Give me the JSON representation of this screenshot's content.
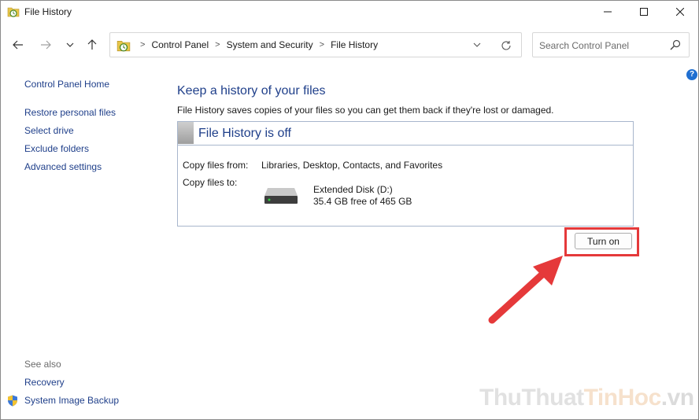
{
  "window": {
    "title": "File History"
  },
  "address": {
    "crumbs": [
      "Control Panel",
      "System and Security",
      "File History"
    ],
    "search_placeholder": "Search Control Panel"
  },
  "sidebar": {
    "home": "Control Panel Home",
    "links": [
      "Restore personal files",
      "Select drive",
      "Exclude folders",
      "Advanced settings"
    ],
    "see_also_label": "See also",
    "see_also": [
      "Recovery",
      "System Image Backup"
    ]
  },
  "main": {
    "heading": "Keep a history of your files",
    "description": "File History saves copies of your files so you can get them back if they're lost or damaged.",
    "status_title": "File History is off",
    "copy_from_label": "Copy files from:",
    "copy_from_value": "Libraries, Desktop, Contacts, and Favorites",
    "copy_to_label": "Copy files to:",
    "drive_name": "Extended Disk (D:)",
    "drive_free": "35.4 GB free of 465 GB",
    "turn_on_label": "Turn on"
  },
  "watermark": {
    "part1": "ThuThuat",
    "part2": "TinHoc",
    "part3": ".vn"
  },
  "colors": {
    "link": "#1f3f8a",
    "highlight": "#e5393a",
    "help": "#1f6fd1"
  },
  "icons": [
    "file-history-icon",
    "minimize-icon",
    "maximize-icon",
    "close-icon",
    "back-arrow-icon",
    "forward-arrow-icon",
    "recent-dropdown-icon",
    "up-arrow-icon",
    "chevron-down-icon",
    "refresh-icon",
    "search-icon",
    "help-icon",
    "drive-icon",
    "shield-icon"
  ]
}
